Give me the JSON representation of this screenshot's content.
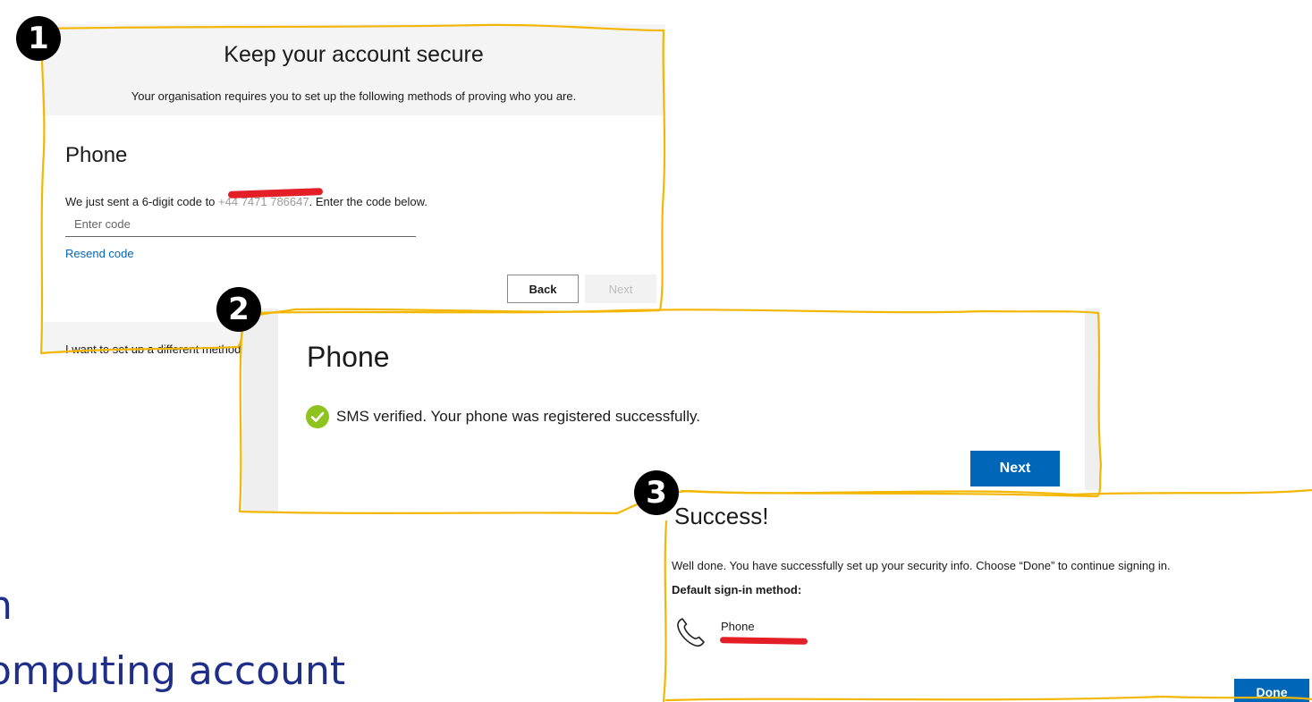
{
  "background_text": {
    "line1": "n",
    "line2": "omputing account"
  },
  "badges": [
    "1",
    "2",
    "3"
  ],
  "step1": {
    "title": "Keep your account secure",
    "subtitle": "Your organisation requires you to set up the following methods of proving who you are.",
    "section_title": "Phone",
    "sent_prefix": "We just sent a 6-digit code to ",
    "sent_number": "+44 7471 786647",
    "sent_suffix": ". Enter the code below.",
    "code_placeholder": "Enter code",
    "resend_label": "Resend code",
    "back_label": "Back",
    "next_label": "Next",
    "different_method": "I want to set up a different method"
  },
  "step2": {
    "section_title": "Phone",
    "verified_text": "SMS verified. Your phone was registered successfully.",
    "next_label": "Next"
  },
  "step3": {
    "title": "Success!",
    "message": "Well done. You have successfully set up your security info. Choose “Done” to continue signing in.",
    "default_label": "Default sign-in method:",
    "method_label": "Phone",
    "done_label": "Done"
  },
  "colors": {
    "accent": "#0067b8",
    "outline": "#f2b705",
    "redaction": "#e41e26",
    "check": "#8fc31f",
    "slide_text": "#1f2e88"
  },
  "icons": {
    "step2_check": "check-circle-icon",
    "step3_method": "phone-icon"
  }
}
